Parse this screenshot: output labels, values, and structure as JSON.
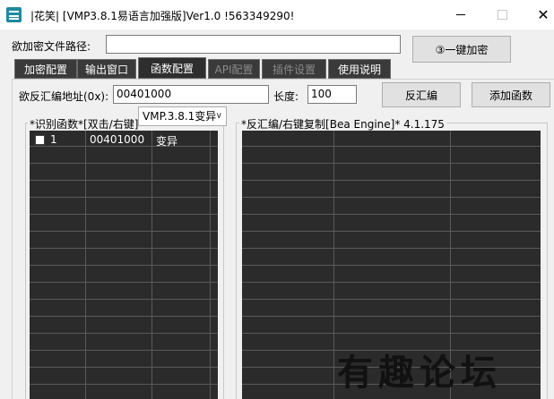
{
  "window": {
    "title": "|花笑|  [VMP3.8.1易语言加强版]Ver1.0 !563349290!",
    "close_glyph": "✕"
  },
  "form": {
    "path_label": "欲加密文件路径:",
    "path_value": "",
    "encrypt_button": "③一键加密"
  },
  "tabs": [
    {
      "label": "加密配置"
    },
    {
      "label": "输出窗口"
    },
    {
      "label": "函数配置"
    },
    {
      "label": "API配置"
    },
    {
      "label": "插件设置"
    },
    {
      "label": "使用说明"
    }
  ],
  "function_config": {
    "addr_label": "欲反汇编地址(0x):",
    "addr_value": "00401000",
    "len_label": "长度:",
    "len_value": "100",
    "disasm_button": "反汇编",
    "add_function_button": "添加函数",
    "left_group_title": "*识别函数*[双击/右键]",
    "mode_select": "VMP.3.8.1变异",
    "right_group_title": "*反汇编/右键复制[Bea Engine]* 4.1.175",
    "functions": [
      {
        "index": "1",
        "address": "00401000",
        "mode": "变异"
      }
    ]
  },
  "watermark": "有趣论坛",
  "colors": {
    "grid_bg": "#2b2b2b",
    "tab_bg": "#3a3a3a",
    "app_icon": "#1e8a9e"
  }
}
